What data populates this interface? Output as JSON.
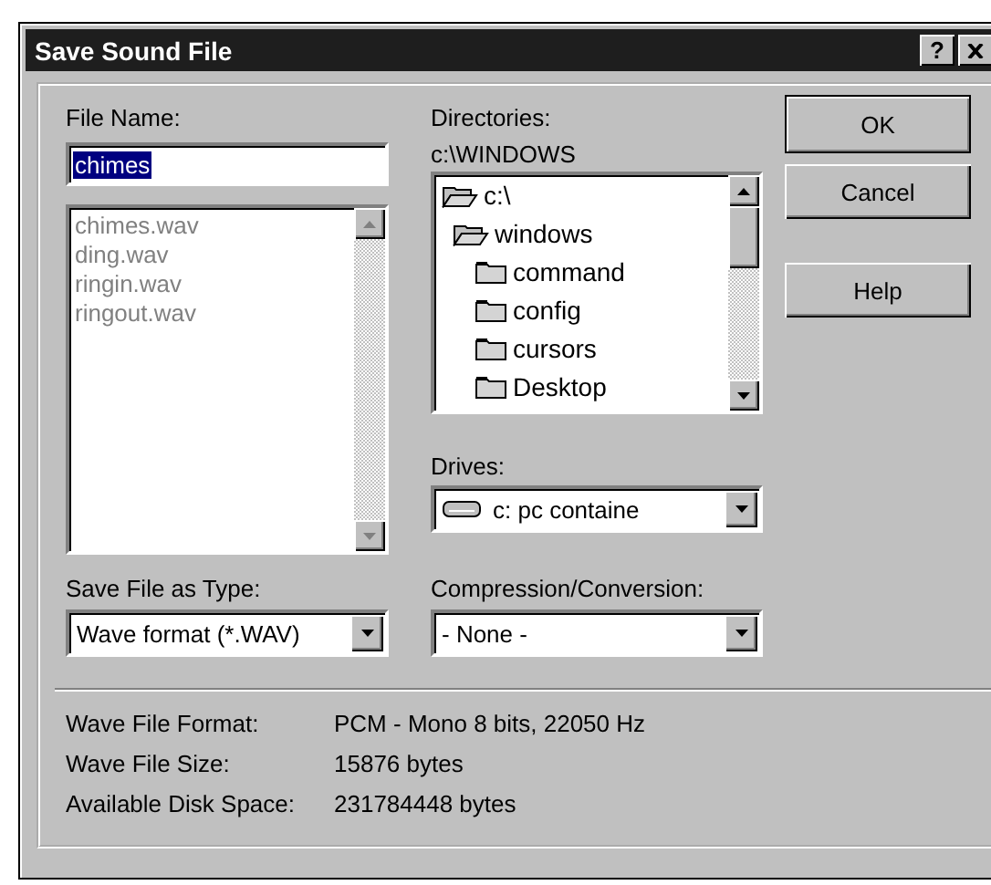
{
  "window": {
    "title": "Save Sound File",
    "help_button": "?",
    "close_button": true
  },
  "file_name": {
    "label": "File Name:",
    "value": "chimes",
    "selected": true
  },
  "file_list": {
    "disabled": true,
    "items": [
      {
        "name": "chimes.wav"
      },
      {
        "name": "ding.wav"
      },
      {
        "name": "ringin.wav"
      },
      {
        "name": "ringout.wav"
      }
    ]
  },
  "directories": {
    "label": "Directories:",
    "current": "c:\\WINDOWS",
    "tree": [
      {
        "name": "c:\\",
        "expanded": true,
        "children": [
          {
            "name": "windows",
            "expanded": true,
            "children": [
              {
                "name": "command",
                "expanded": false
              },
              {
                "name": "config",
                "expanded": false
              },
              {
                "name": "cursors",
                "expanded": false
              },
              {
                "name": "Desktop",
                "expanded": false
              }
            ]
          }
        ]
      }
    ]
  },
  "buttons": [
    {
      "label": "OK",
      "default": true
    },
    {
      "label": "Cancel",
      "default": false
    },
    {
      "label": "Help",
      "default": false
    }
  ],
  "drives": {
    "label": "Drives:",
    "value": "c: pc containe"
  },
  "save_type": {
    "label": "Save File as Type:",
    "value": "Wave format (*.WAV)"
  },
  "compression": {
    "label": "Compression/Conversion:",
    "value": "- None -"
  },
  "info": [
    {
      "label": "Wave File Format:",
      "value": "PCM - Mono 8 bits, 22050 Hz"
    },
    {
      "label": "Wave File Size:",
      "value": "15876 bytes"
    },
    {
      "label": "Available Disk Space:",
      "value": "231784448 bytes"
    }
  ]
}
